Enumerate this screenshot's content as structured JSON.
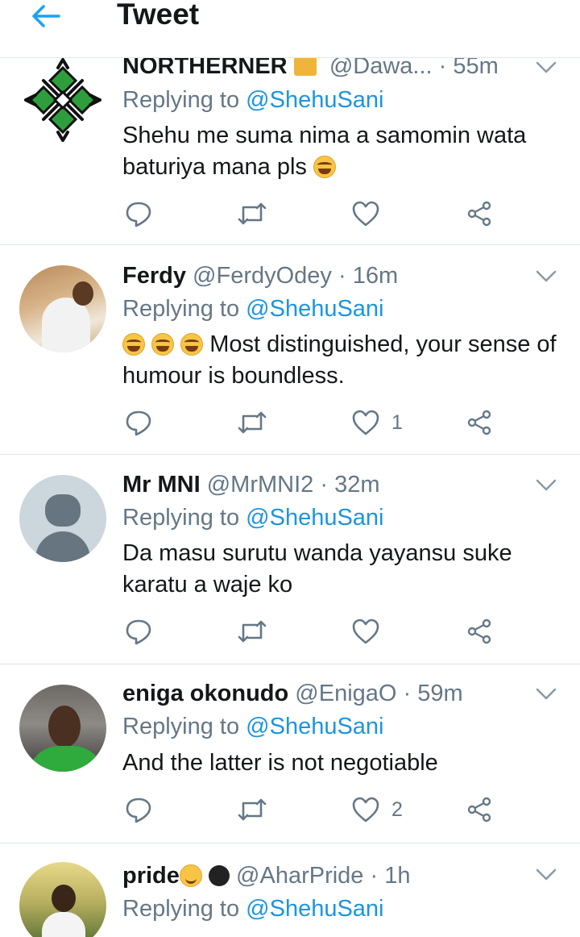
{
  "header": {
    "title": "Tweet"
  },
  "colors": {
    "link": "#1b95e0",
    "muted": "#657786",
    "text": "#14171a",
    "divider": "#e1e8ed"
  },
  "tweets": [
    {
      "name": "NORTHERNER",
      "handle": "@Dawa...",
      "time": "55m",
      "reply_prefix": "Replying to ",
      "reply_to": "@ShehuSani",
      "text": "Shehu me suma nima a samomin wata baturiya mana pls",
      "likes": ""
    },
    {
      "name": "Ferdy",
      "handle": "@FerdyOdey",
      "time": "16m",
      "reply_prefix": "Replying to ",
      "reply_to": "@ShehuSani",
      "text": "Most distinguished, your sense of humour is boundless.",
      "likes": "1"
    },
    {
      "name": "Mr MNI",
      "handle": "@MrMNI2",
      "time": "32m",
      "reply_prefix": "Replying to ",
      "reply_to": "@ShehuSani",
      "text": "Da masu surutu wanda yayansu suke karatu a waje ko",
      "likes": ""
    },
    {
      "name": "eniga okonudo",
      "handle": "@EnigaO",
      "time": "59m",
      "reply_prefix": "Replying to ",
      "reply_to": "@ShehuSani",
      "text": "And the latter is not negotiable",
      "likes": "2"
    },
    {
      "name": "pride",
      "handle": "@AharPride",
      "time": "1h",
      "reply_prefix": "Replying to ",
      "reply_to": "@ShehuSani",
      "text": "",
      "likes": ""
    }
  ],
  "separator": "·",
  "icons": [
    "back-arrow-icon",
    "chevron-down-icon",
    "reply-icon",
    "retweet-icon",
    "like-icon",
    "share-icon"
  ]
}
